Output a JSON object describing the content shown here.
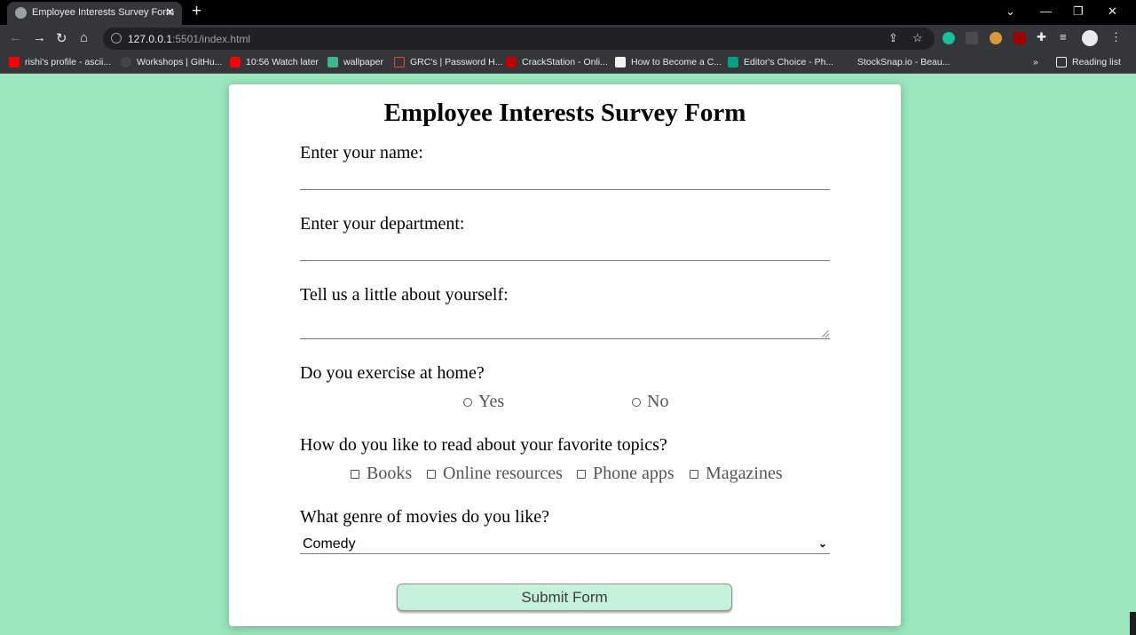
{
  "browser": {
    "tab_title": "Employee Interests Survey Form",
    "url_host": "127.0.0.1",
    "url_rest": ":5501/index.html",
    "bookmarks": [
      {
        "label": "rishi's profile - ascii...",
        "color": "#ff0000"
      },
      {
        "label": "Workshops | GitHu...",
        "color": "#444444"
      },
      {
        "label": "10:56 Watch later",
        "color": "#ff0000"
      },
      {
        "label": "wallpaper",
        "color": "#3fb68b"
      },
      {
        "label": "GRC's | Password H...",
        "color": "#ffffff"
      },
      {
        "label": "CrackStation - Onli...",
        "color": "#c00000"
      },
      {
        "label": "How to Become a C...",
        "color": "#f2f2f2"
      },
      {
        "label": "Editor's Choice - Ph...",
        "color": "#05a081"
      },
      {
        "label": "StockSnap.io - Beau...",
        "color": "#35363a"
      }
    ],
    "overflow_label": "»",
    "reading_list_label": "Reading list"
  },
  "form": {
    "title": "Employee Interests Survey Form",
    "name_label": "Enter your name:",
    "department_label": "Enter your department:",
    "about_label": "Tell us a little about yourself:",
    "exercise_label": "Do you exercise at home?",
    "exercise_options": [
      "Yes",
      "No"
    ],
    "reading_label": "How do you like to read about your favorite topics?",
    "reading_options": [
      "Books",
      "Online resources",
      "Phone apps",
      "Magazines"
    ],
    "genre_label": "What genre of movies do you like?",
    "genre_selected": "Comedy",
    "submit_label": "Submit Form"
  }
}
